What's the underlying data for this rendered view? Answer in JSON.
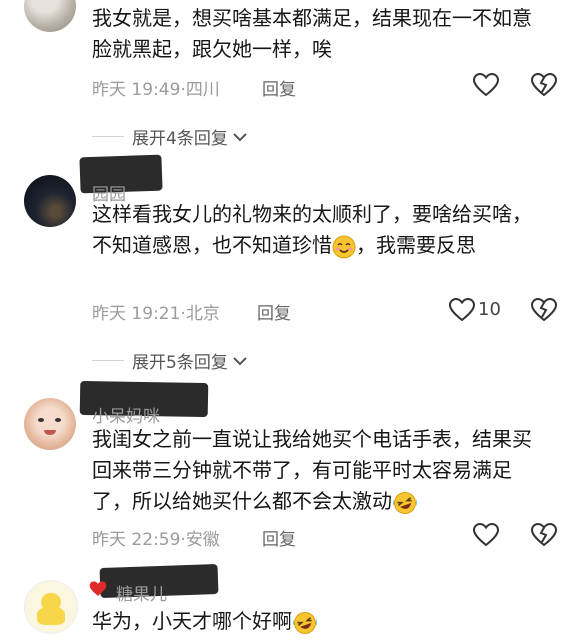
{
  "comments": [
    {
      "username": "",
      "text": "我女就是，想买啥基本都满足，结果现在一不如意脸就黑起，跟欠她一样，唉",
      "time": "昨天 19:49",
      "location": "四川",
      "reply_label": "回复",
      "likes": ""
    },
    {
      "username": "园园",
      "text_before_emoji": "这样看我女儿的礼物来的太顺利了，要啥给买啥，不知道感恩，也不知道珍惜",
      "emoji": "smiling-face-emoji",
      "text_after_emoji": "，我需要反思",
      "time": "昨天 19:21",
      "location": "北京",
      "reply_label": "回复",
      "likes": "10"
    },
    {
      "username": "小呆妈咪",
      "text_before_emoji": "我闺女之前一直说让我给她买个电话手表，结果买回来带三分钟就不带了，有可能平时太容易满足了，所以给她买什么都不会太激动",
      "emoji": "rolling-laughing-emoji",
      "time": "昨天 22:59",
      "location": "安徽",
      "reply_label": "回复",
      "likes": ""
    },
    {
      "username": "糖果儿",
      "text_before_emoji": "华为，小天才哪个好啊",
      "emoji": "rolling-laughing-emoji"
    }
  ],
  "expand_replies": [
    {
      "label": "展开4条回复"
    },
    {
      "label": "展开5条回复"
    }
  ],
  "colors": {
    "text": "#161616",
    "meta": "#9b9b9b",
    "icon": "#333333"
  }
}
